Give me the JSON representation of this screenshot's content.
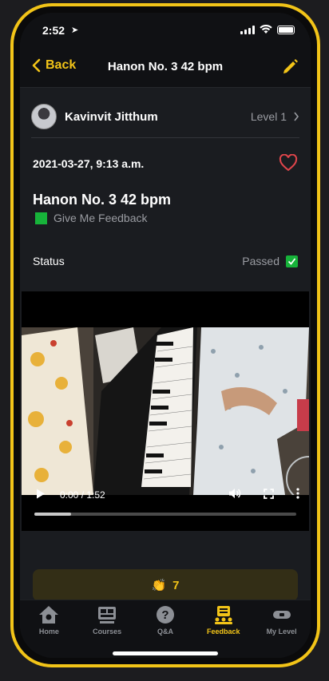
{
  "status_bar": {
    "time": "2:52",
    "location_icon": "location-arrow-icon"
  },
  "nav": {
    "back_label": "Back",
    "title": "Hanon No. 3 42 bpm",
    "edit_icon": "pencil-icon"
  },
  "user": {
    "name": "Kavinvit Jitthum",
    "level": "Level 1"
  },
  "entry": {
    "date": "2021-03-27, 9:13 a.m.",
    "title": "Hanon No. 3 42 bpm",
    "feedback_tag": "Give Me Feedback",
    "status_label": "Status",
    "status_value": "Passed"
  },
  "video": {
    "time": "0:00 / 1:52",
    "progress": 0.14
  },
  "clap": {
    "count": "7",
    "emoji": "👏"
  },
  "tabs": [
    {
      "label": "Home",
      "icon": "home-icon"
    },
    {
      "label": "Courses",
      "icon": "courses-icon"
    },
    {
      "label": "Q&A",
      "icon": "question-icon"
    },
    {
      "label": "Feedback",
      "icon": "feedback-icon",
      "active": true
    },
    {
      "label": "My Level",
      "icon": "level-icon"
    }
  ],
  "colors": {
    "accent": "#f2c418",
    "green": "#17b33a",
    "heart": "#e0454b"
  }
}
